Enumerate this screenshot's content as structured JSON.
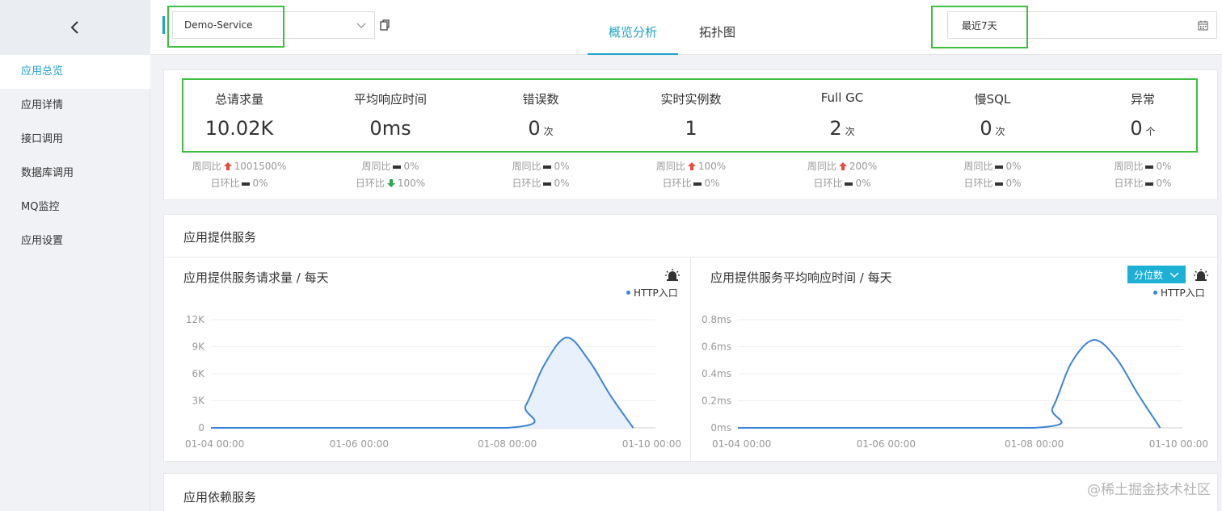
{
  "sidebar": {
    "back_icon": "chevron-left-icon",
    "items": [
      {
        "label": "应用总览",
        "active": true
      },
      {
        "label": "应用详情",
        "active": false
      },
      {
        "label": "接口调用",
        "active": false
      },
      {
        "label": "数据库调用",
        "active": false
      },
      {
        "label": "MQ监控",
        "active": false
      },
      {
        "label": "应用设置",
        "active": false
      }
    ]
  },
  "topbar": {
    "service_value": "Demo-Service",
    "tabs": [
      {
        "label": "概览分析",
        "active": true
      },
      {
        "label": "拓扑图",
        "active": false
      }
    ],
    "date_value": "最近7天"
  },
  "stats": [
    {
      "label": "总请求量",
      "value": "10.02K",
      "unit": "",
      "week_label": "周同比",
      "week_trend": "up",
      "week_value": "1001500%",
      "day_label": "日环比",
      "day_trend": "flat",
      "day_value": "0%"
    },
    {
      "label": "平均响应时间",
      "value": "0ms",
      "unit": "",
      "week_label": "周同比",
      "week_trend": "flat",
      "week_value": "0%",
      "day_label": "日环比",
      "day_trend": "down",
      "day_value": "100%"
    },
    {
      "label": "错误数",
      "value": "0",
      "unit": "次",
      "week_label": "周同比",
      "week_trend": "flat",
      "week_value": "0%",
      "day_label": "日环比",
      "day_trend": "flat",
      "day_value": "0%"
    },
    {
      "label": "实时实例数",
      "value": "1",
      "unit": "",
      "week_label": "周同比",
      "week_trend": "up",
      "week_value": "100%",
      "day_label": "日环比",
      "day_trend": "flat",
      "day_value": "0%"
    },
    {
      "label": "Full GC",
      "value": "2",
      "unit": "次",
      "week_label": "周同比",
      "week_trend": "up",
      "week_value": "200%",
      "day_label": "日环比",
      "day_trend": "flat",
      "day_value": "0%"
    },
    {
      "label": "慢SQL",
      "value": "0",
      "unit": "次",
      "week_label": "周同比",
      "week_trend": "flat",
      "week_value": "0%",
      "day_label": "日环比",
      "day_trend": "flat",
      "day_value": "0%"
    },
    {
      "label": "异常",
      "value": "0",
      "unit": "个",
      "week_label": "周同比",
      "week_trend": "flat",
      "week_value": "0%",
      "day_label": "日环比",
      "day_trend": "flat",
      "day_value": "0%"
    }
  ],
  "provided_section": {
    "title": "应用提供服务",
    "percentile_label": "分位数"
  },
  "dependency_section": {
    "title": "应用依赖服务"
  },
  "colors": {
    "accent": "#1fa3c7",
    "line": "#3a84d8",
    "area": "#e8f0fb",
    "up": "#e84a3c",
    "down": "#2aa84a",
    "highlight_box": "#3fbf3f"
  },
  "watermark": "@稀土掘金技术社区",
  "chart_data": [
    {
      "type": "area",
      "title": "应用提供服务请求量 / 每天",
      "x_ticks": [
        "01-04 00:00",
        "01-06 00:00",
        "01-08 00:00",
        "01-10 00:00"
      ],
      "y_ticks": [
        "0",
        "3K",
        "6K",
        "9K",
        "12K"
      ],
      "ylim": [
        0,
        12000
      ],
      "xlim_days": [
        0,
        6
      ],
      "series": [
        {
          "name": "HTTP入口",
          "points": [
            [
              0,
              0
            ],
            [
              4.0,
              0
            ],
            [
              4.25,
              2500
            ],
            [
              4.5,
              7000
            ],
            [
              4.8,
              10020
            ],
            [
              5.1,
              7500
            ],
            [
              5.4,
              3500
            ],
            [
              5.7,
              0
            ]
          ]
        }
      ],
      "legend": "top-right",
      "grid": true
    },
    {
      "type": "line",
      "title": "应用提供服务平均响应时间 / 每天",
      "x_ticks": [
        "01-04 00:00",
        "01-06 00:00",
        "01-08 00:00",
        "01-10 00:00"
      ],
      "y_ticks": [
        "0ms",
        "0.2ms",
        "0.4ms",
        "0.6ms",
        "0.8ms"
      ],
      "ylim": [
        0,
        0.8
      ],
      "xlim_days": [
        0,
        6
      ],
      "series": [
        {
          "name": "HTTP入口",
          "points": [
            [
              0,
              0
            ],
            [
              4.0,
              0
            ],
            [
              4.25,
              0.15
            ],
            [
              4.5,
              0.48
            ],
            [
              4.8,
              0.65
            ],
            [
              5.1,
              0.52
            ],
            [
              5.4,
              0.25
            ],
            [
              5.7,
              0
            ]
          ]
        }
      ],
      "legend": "top-right",
      "grid": true
    }
  ]
}
